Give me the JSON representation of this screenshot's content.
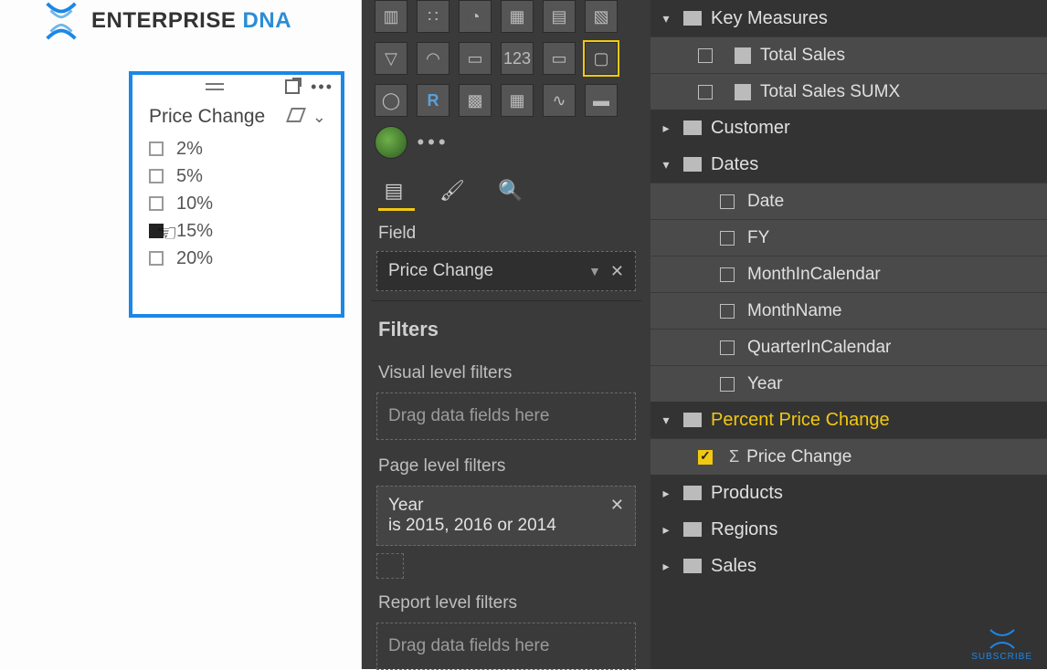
{
  "logo": {
    "text1": "ENTERPRISE ",
    "text2": "DNA"
  },
  "slicer": {
    "title": "Price Change",
    "items": [
      {
        "label": "2%",
        "checked": false
      },
      {
        "label": "5%",
        "checked": false
      },
      {
        "label": "10%",
        "checked": false
      },
      {
        "label": "15%",
        "checked": true
      },
      {
        "label": "20%",
        "checked": false
      }
    ]
  },
  "vis_pane": {
    "field_label": "Field",
    "field_value": "Price Change",
    "filters_header": "Filters",
    "visual_level_label": "Visual level filters",
    "visual_drop_placeholder": "Drag data fields here",
    "page_level_label": "Page level filters",
    "page_filter_field": "Year",
    "page_filter_desc": "is 2015, 2016 or 2014",
    "report_level_label": "Report level filters",
    "report_drop_placeholder": "Drag data fields here"
  },
  "fields": {
    "key_measures": {
      "label": "Key Measures",
      "items": [
        "Total Sales",
        "Total Sales SUMX"
      ]
    },
    "customer": {
      "label": "Customer"
    },
    "dates": {
      "label": "Dates",
      "items": [
        "Date",
        "FY",
        "MonthInCalendar",
        "MonthName",
        "QuarterInCalendar",
        "Year"
      ]
    },
    "ppc": {
      "label": "Percent Price Change",
      "items": [
        {
          "label": "Price Change",
          "checked": true
        }
      ]
    },
    "products": {
      "label": "Products"
    },
    "regions": {
      "label": "Regions"
    },
    "sales": {
      "label": "Sales"
    }
  },
  "subscribe": "SUBSCRIBE"
}
